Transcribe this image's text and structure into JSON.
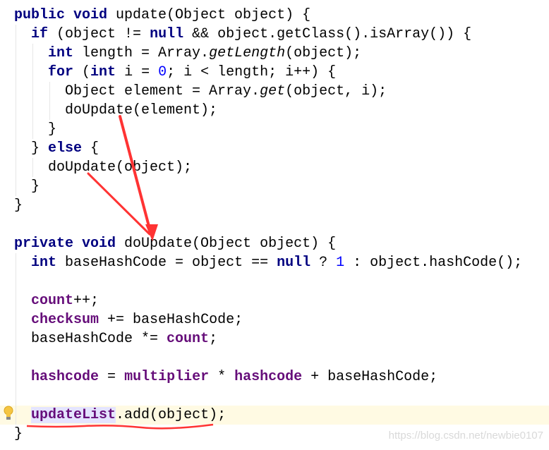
{
  "editor": {
    "highlight_color": "#fffae3",
    "keyword_color": "#000080",
    "field_color": "#660e7a",
    "number_color": "#0000ff",
    "annotation_color": "#ff3333",
    "lines": [
      {
        "indent": 0,
        "tokens": [
          [
            "kw",
            "public void "
          ],
          [
            "",
            "update(Object object) {"
          ]
        ]
      },
      {
        "indent": 1,
        "tokens": [
          [
            "kw",
            "if "
          ],
          [
            "",
            "(object != "
          ],
          [
            "kw",
            "null"
          ],
          [
            "",
            " && object.getClass().isArray()) {"
          ]
        ]
      },
      {
        "indent": 2,
        "tokens": [
          [
            "kw",
            "int "
          ],
          [
            "",
            "length = Array."
          ],
          [
            "it",
            "getLength"
          ],
          [
            "",
            "(object);"
          ]
        ]
      },
      {
        "indent": 2,
        "tokens": [
          [
            "kw",
            "for "
          ],
          [
            "",
            "("
          ],
          [
            "kw",
            "int "
          ],
          [
            "",
            "i = "
          ],
          [
            "num",
            "0"
          ],
          [
            "",
            "; i < length; i++) {"
          ]
        ]
      },
      {
        "indent": 3,
        "tokens": [
          [
            "",
            "Object element = Array."
          ],
          [
            "it",
            "get"
          ],
          [
            "",
            "(object, i);"
          ]
        ]
      },
      {
        "indent": 3,
        "tokens": [
          [
            "",
            "doUpdate(element);"
          ]
        ]
      },
      {
        "indent": 2,
        "tokens": [
          [
            "",
            "}"
          ]
        ]
      },
      {
        "indent": 1,
        "tokens": [
          [
            "",
            "} "
          ],
          [
            "kw",
            "else "
          ],
          [
            "",
            "{"
          ]
        ]
      },
      {
        "indent": 2,
        "tokens": [
          [
            "",
            "doUpdate(object);"
          ]
        ]
      },
      {
        "indent": 1,
        "tokens": [
          [
            "",
            "}"
          ]
        ]
      },
      {
        "indent": 0,
        "tokens": [
          [
            "",
            "}"
          ]
        ]
      },
      {
        "indent": 0,
        "tokens": []
      },
      {
        "indent": 0,
        "tokens": [
          [
            "kw",
            "private void "
          ],
          [
            "",
            "doUpdate(Object object) {"
          ]
        ]
      },
      {
        "indent": 1,
        "tokens": [
          [
            "kw",
            "int "
          ],
          [
            "",
            "baseHashCode = object == "
          ],
          [
            "kw",
            "null "
          ],
          [
            "",
            "? "
          ],
          [
            "num",
            "1"
          ],
          [
            "",
            " : object.hashCode();"
          ]
        ]
      },
      {
        "indent": 1,
        "tokens": []
      },
      {
        "indent": 1,
        "tokens": [
          [
            "fld",
            "count"
          ],
          [
            "",
            "++;"
          ]
        ]
      },
      {
        "indent": 1,
        "tokens": [
          [
            "fld",
            "checksum "
          ],
          [
            "",
            "+= baseHashCode;"
          ]
        ]
      },
      {
        "indent": 1,
        "tokens": [
          [
            "",
            "baseHashCode *= "
          ],
          [
            "fld",
            "count"
          ],
          [
            "",
            ";"
          ]
        ]
      },
      {
        "indent": 1,
        "tokens": []
      },
      {
        "indent": 1,
        "tokens": [
          [
            "fld",
            "hashcode "
          ],
          [
            "",
            "= "
          ],
          [
            "fld",
            "multiplier "
          ],
          [
            "",
            "* "
          ],
          [
            "fld",
            "hashcode "
          ],
          [
            "",
            "+ baseHashCode;"
          ]
        ]
      },
      {
        "indent": 1,
        "tokens": []
      },
      {
        "indent": 1,
        "highlight": true,
        "tokens": [
          [
            "fld sel",
            "updateList"
          ],
          [
            "",
            ".add(object);"
          ]
        ]
      },
      {
        "indent": 0,
        "tokens": [
          [
            "",
            "}"
          ]
        ]
      }
    ]
  },
  "icons": {
    "bulb": "lightbulb-icon"
  },
  "watermark": "https://blog.csdn.net/newbie0107"
}
